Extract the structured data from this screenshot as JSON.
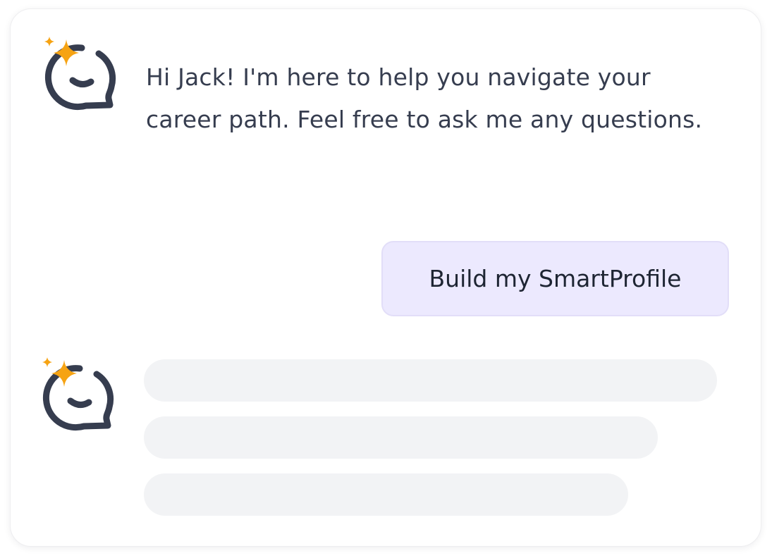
{
  "conversation": {
    "assistant_message": "Hi Jack! I'm here to help you navigate your career path. Feel free to ask me any questions.",
    "user_message": "Build my SmartProfile"
  },
  "icons": {
    "assistant_avatar": "sparkle-chat-bubble-icon"
  },
  "colors": {
    "icon_stroke": "#363d4f",
    "sparkle": "#f6a313",
    "user_bubble_bg": "#ece9fe",
    "skeleton": "#f2f3f5",
    "text": "#363d4f"
  }
}
